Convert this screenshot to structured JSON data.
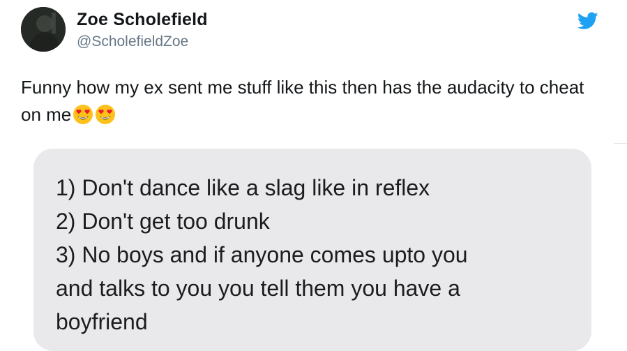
{
  "tweet": {
    "author_name": "Zoe Scholefield",
    "handle": "@ScholefieldZoe",
    "text": "Funny how my ex sent me stuff like this then has the audacity to cheat on me",
    "emojis": [
      "smiling-face-with-heart-eyes",
      "smiling-face-with-heart-eyes"
    ]
  },
  "message_bubble": {
    "lines": [
      "1) Don't dance like a slag like in reflex",
      "2) Don't get too drunk",
      "3) No boys and if anyone comes upto you",
      "and talks to you you tell them you have a",
      "boyfriend"
    ]
  },
  "colors": {
    "twitter_blue": "#1da1f2",
    "handle_gray": "#657786",
    "bubble_gray": "#e9e9eb"
  },
  "icons": {
    "brand": "twitter-bird-icon",
    "avatar": "avatar"
  }
}
